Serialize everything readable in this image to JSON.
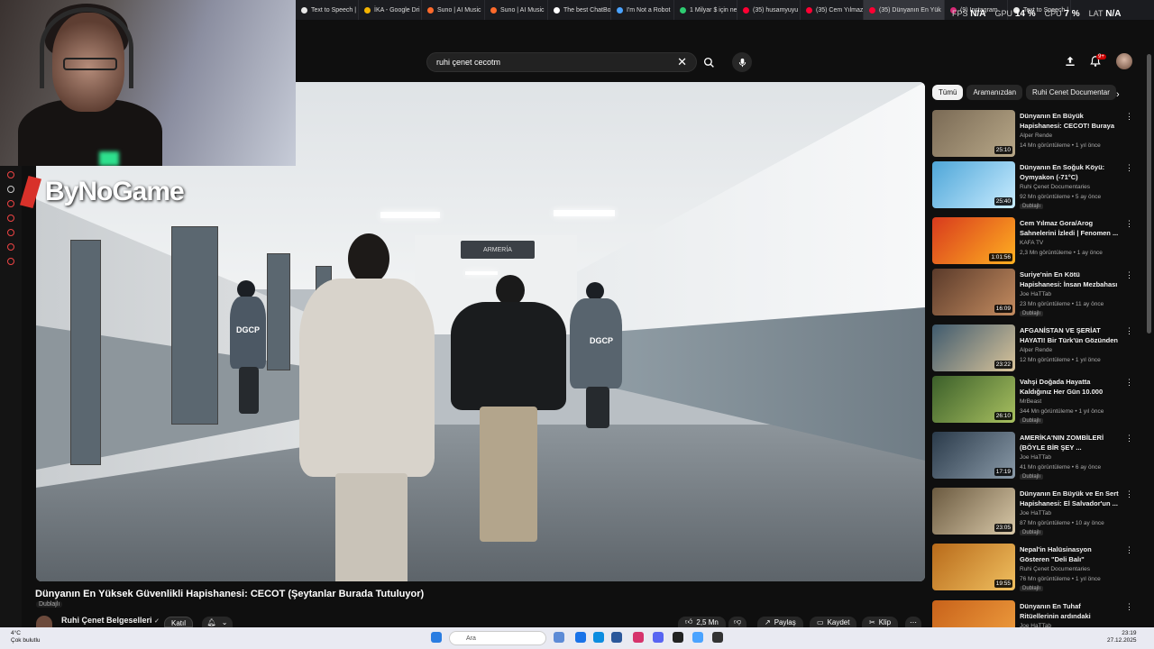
{
  "browser": {
    "tabs": [
      {
        "label": "Text to Speech |",
        "color": "#e8e8e8"
      },
      {
        "label": "İKA - Google Dri",
        "color": "#f4b400"
      },
      {
        "label": "Suno | AI Music",
        "color": "#ff6a2b"
      },
      {
        "label": "Suno | AI Music",
        "color": "#ff6a2b"
      },
      {
        "label": "The best ChatBo",
        "color": "#ffffff"
      },
      {
        "label": "I'm Not a Robot",
        "color": "#4aa3ff"
      },
      {
        "label": "1 Milyar $ için ne",
        "color": "#2ecc71"
      },
      {
        "label": "(35) husamyuyu",
        "color": "#ff0033"
      },
      {
        "label": "(35) Cem Yılmaz",
        "color": "#ff0033"
      },
      {
        "label": "(35) Dünyanın En Yük",
        "color": "#ff0033",
        "active": true
      },
      {
        "label": "(9) Instagram",
        "color": "#d62976"
      },
      {
        "label": "Text to Speech |",
        "color": "#e8e8e8"
      }
    ]
  },
  "hud": {
    "fps_label": "FPS",
    "fps_value": "N/A",
    "gpu_label": "GPU",
    "gpu_value": "14 %",
    "cpu_label": "CPU",
    "cpu_value": "7 %",
    "lat_label": "LAT",
    "lat_value": "N/A"
  },
  "header": {
    "search_value": "ruhi çenet cecotm",
    "notification_count": "9+"
  },
  "overlay": {
    "logo_text": "ByNoGame"
  },
  "video": {
    "sign_text": "ARMERÍA",
    "vest_left": "DGCP",
    "vest_right": "DGCP"
  },
  "main": {
    "title": "Dünyanın En Yüksek Güvenlikli Hapishanesi: CECOT (Şeytanlar Burada Tutuluyor)",
    "dubbed": "Dublajlı",
    "channel": "Ruhi Çenet Belgeselleri",
    "join_label": "Katıl",
    "likes": "2,5 Mn",
    "share_label": "Paylaş",
    "save_label": "Kaydet",
    "clip_label": "Klip"
  },
  "chips": [
    "Tümü",
    "Aramanızdan",
    "Ruhi Cenet Documentar"
  ],
  "related": [
    {
      "title": "Dünyanın En Büyük Hapishanesi: CECOT! Buraya ...",
      "channel": "Alper Rende",
      "meta": "14 Mn görüntüleme • 1 yıl önce",
      "duration": "25:10",
      "dub": "",
      "c1": "#7a6a55",
      "c2": "#b8a888"
    },
    {
      "title": "Dünyanın En Soğuk Köyü: Oymyakon (-71°C)",
      "channel": "Ruhi Çenet Documentaries",
      "meta": "92 Mn görüntüleme • 5 ay önce",
      "duration": "25:40",
      "dub": "Dublajlı",
      "c1": "#4ea6d8",
      "c2": "#c9ecff"
    },
    {
      "title": "Cem Yılmaz Gora/Arog Sahnelerini İzledi | Fenomen ...",
      "channel": "KAFA TV",
      "meta": "2,3 Mn görüntüleme • 1 ay önce",
      "duration": "1:01:56",
      "dub": "",
      "c1": "#d83a1e",
      "c2": "#ffb020"
    },
    {
      "title": "Suriye'nin En Kötü Hapishanesi: İnsan Mezbahası",
      "channel": "Joe HaTTab",
      "meta": "23 Mn görüntüleme • 11 ay önce",
      "duration": "16:09",
      "dub": "Dublajlı",
      "c1": "#5a3a2a",
      "c2": "#c48c60"
    },
    {
      "title": "AFGANİSTAN VE ŞERİAT HAYATI! Bir Türk'ün Gözünden ...",
      "channel": "Alper Rende",
      "meta": "12 Mn görüntüleme • 1 yıl önce",
      "duration": "23:22",
      "dub": "",
      "c1": "#3f5a6e",
      "c2": "#d9c49a"
    },
    {
      "title": "Vahşi Doğada Hayatta Kaldığınız Her Gün 10.000 Dolar",
      "channel": "MrBeast",
      "meta": "344 Mn görüntüleme • 1 yıl önce",
      "duration": "26:10",
      "dub": "Dublajlı",
      "c1": "#3b5f2a",
      "c2": "#a8c060"
    },
    {
      "title": "AMERİKA'NIN ZOMBİLERİ (BÖYLE BİR ŞEY ...",
      "channel": "Joe HaTTab",
      "meta": "41 Mn görüntüleme • 6 ay önce",
      "duration": "17:19",
      "dub": "Dublajlı",
      "c1": "#2a3a4a",
      "c2": "#8a9aa8"
    },
    {
      "title": "Dünyanın En Büyük ve En Sert Hapishanesi: El Salvador'un ...",
      "channel": "Joe HaTTab",
      "meta": "87 Mn görüntüleme • 10 ay önce",
      "duration": "23:05",
      "dub": "Dublajlı",
      "c1": "#6b5a40",
      "c2": "#d8c8a8"
    },
    {
      "title": "Nepal'in Halüsinasyon Gösteren \"Deli Balı\" (Delirmek...",
      "channel": "Ruhi Çenet Documentaries",
      "meta": "76 Mn görüntüleme • 1 yıl önce",
      "duration": "19:55",
      "dub": "Dublajlı",
      "c1": "#b86a1a",
      "c2": "#f0c060"
    },
    {
      "title": "Dünyanın En Tuhaf Ritüellerinin ardındaki GERÇEK: Vudu sı",
      "channel": "Joe HaTTab",
      "meta": "",
      "duration": "",
      "dub": "",
      "c1": "#c8621a",
      "c2": "#f0a040"
    }
  ],
  "taskbar": {
    "temp": "4°C",
    "weather": "Çok bulutlu",
    "search_placeholder": "Ara",
    "time": "23:19",
    "date": "27.12.2025"
  }
}
